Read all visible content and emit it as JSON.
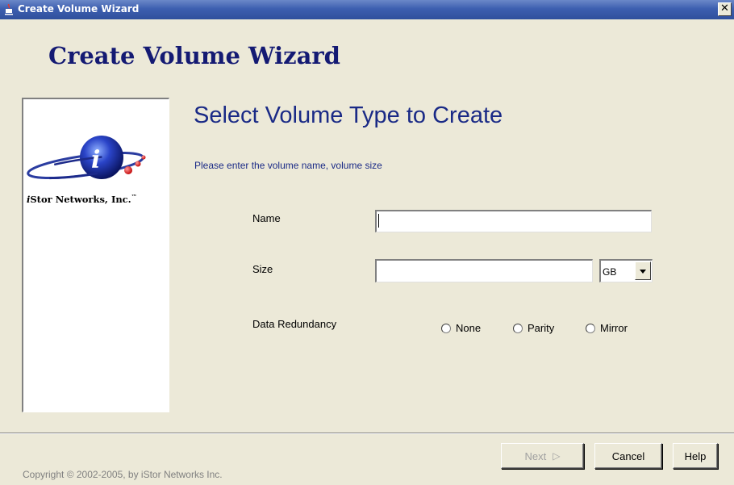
{
  "window": {
    "title": "Create Volume Wizard",
    "close_glyph": "✕",
    "icon": "java-cup-icon"
  },
  "wizard": {
    "heading": "Create Volume Wizard",
    "step_title": "Select Volume Type to Create",
    "instruction": "Please enter the volume name, volume size"
  },
  "sidebar": {
    "logo_icon": "istor-globe-logo",
    "company_name_prefix": "i",
    "company_name_rest": "Stor Networks, Inc.",
    "trademark": "™"
  },
  "form": {
    "name_label": "Name",
    "name_value": "",
    "size_label": "Size",
    "size_value": "",
    "unit_selected": "GB",
    "redundancy_label": "Data Redundancy",
    "redundancy_options": [
      {
        "label": "None",
        "selected": false
      },
      {
        "label": "Parity",
        "selected": false
      },
      {
        "label": "Mirror",
        "selected": false
      }
    ]
  },
  "buttons": {
    "next_label": "Next",
    "next_arrow": "▷",
    "next_enabled": false,
    "cancel_label": "Cancel",
    "help_label": "Help"
  },
  "footer": {
    "copyright": "Copyright © 2002-2005, by iStor Networks Inc."
  },
  "colors": {
    "titlebar": "#3d5fb0",
    "heading": "#141a73",
    "accent_text": "#1a2a86",
    "background": "#ece9d8"
  }
}
